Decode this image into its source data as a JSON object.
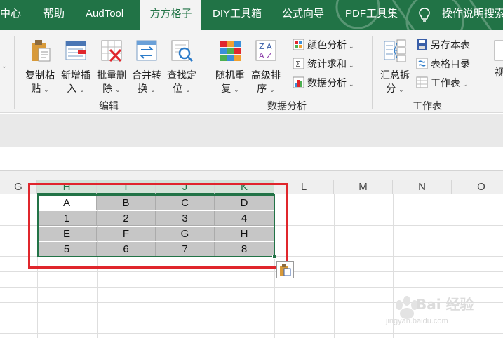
{
  "ribbon_tabs": [
    "中心",
    "帮助",
    "AudTool",
    "方方格子",
    "DIY工具箱",
    "公式向导",
    "PDF工具集",
    "操作说明搜索"
  ],
  "active_tab": "方方格子",
  "ribbon": {
    "edit_group": {
      "label": "编辑",
      "buttons": [
        {
          "line1": "复制粘",
          "line2": "贴",
          "icon": "clipboard-paste-icon"
        },
        {
          "line1": "新增插",
          "line2": "入",
          "icon": "insert-rows-icon"
        },
        {
          "line1": "批量删",
          "line2": "除",
          "icon": "bulk-delete-icon"
        },
        {
          "line1": "合并转",
          "line2": "换",
          "icon": "merge-convert-icon"
        },
        {
          "line1": "查找定",
          "line2": "位",
          "icon": "find-locate-icon"
        }
      ]
    },
    "data_group": {
      "label": "数据分析",
      "buttons": [
        {
          "line1": "随机重",
          "line2": "复",
          "icon": "random-repeat-icon"
        },
        {
          "line1": "高级排",
          "line2": "序",
          "icon": "advanced-sort-icon"
        }
      ],
      "small_buttons": [
        {
          "label": "颜色分析",
          "icon": "color-analysis-icon"
        },
        {
          "label": "统计求和",
          "icon": "stats-sum-icon"
        },
        {
          "label": "数据分析",
          "icon": "data-analysis-icon"
        }
      ]
    },
    "sheet_group": {
      "label": "工作表",
      "button": {
        "line1": "汇总拆",
        "line2": "分",
        "icon": "summary-split-icon"
      },
      "small_buttons": [
        {
          "label": "另存本表",
          "icon": "save-sheet-icon"
        },
        {
          "label": "表格目录",
          "icon": "sheet-directory-icon"
        },
        {
          "label": "工作表",
          "icon": "worksheet-icon"
        }
      ]
    },
    "partial_label": "视"
  },
  "columns": [
    "G",
    "H",
    "I",
    "J",
    "K",
    "L",
    "M",
    "N",
    "O"
  ],
  "selected_columns": [
    "H",
    "I",
    "J",
    "K"
  ],
  "table": [
    [
      "A",
      "B",
      "C",
      "D"
    ],
    [
      "1",
      "2",
      "3",
      "4"
    ],
    [
      "E",
      "F",
      "G",
      "H"
    ],
    [
      "5",
      "6",
      "7",
      "8"
    ]
  ],
  "active_cell": "H1",
  "watermark": {
    "brand": "Bai 经验",
    "url": "jingyan.baidu.com"
  },
  "colors": {
    "excel_green": "#217346",
    "highlight_red": "#e0262c",
    "selection_gray": "#c6c6c6"
  }
}
